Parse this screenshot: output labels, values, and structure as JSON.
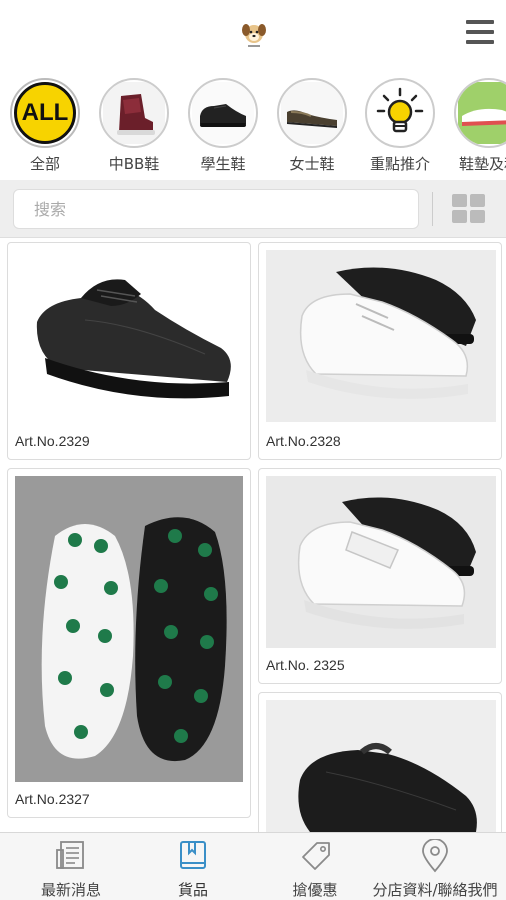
{
  "header": {
    "logo_icon": "dog-logo-icon",
    "menu_icon": "hamburger-menu-icon"
  },
  "categories": [
    {
      "label": "全部",
      "badge": "ALL",
      "icon": "all-badge-icon"
    },
    {
      "label": "中BB鞋",
      "icon": "kids-boot-icon"
    },
    {
      "label": "學生鞋",
      "icon": "student-shoe-icon"
    },
    {
      "label": "女士鞋",
      "icon": "ladies-shoe-icon"
    },
    {
      "label": "重點推介",
      "icon": "lightbulb-icon"
    },
    {
      "label": "鞋墊及和",
      "icon": "insole-icon"
    }
  ],
  "search": {
    "placeholder": "搜索"
  },
  "products": [
    {
      "name": "Art.No.2329"
    },
    {
      "name": "Art.No.2328"
    },
    {
      "name": "Art.No.2327"
    },
    {
      "name": "Art.No. 2325"
    },
    {
      "name": ""
    }
  ],
  "bottom_nav": [
    {
      "label": "最新消息",
      "icon": "newspaper-icon"
    },
    {
      "label": "貨品",
      "icon": "book-icon",
      "active": true
    },
    {
      "label": "搶優惠",
      "icon": "tag-icon"
    },
    {
      "label": "分店資料/聯絡我們",
      "icon": "map-pin-icon"
    }
  ],
  "colors": {
    "accent": "#3a8fc7",
    "all_badge": "#f7d300",
    "bg_bar": "#eeeeee"
  }
}
